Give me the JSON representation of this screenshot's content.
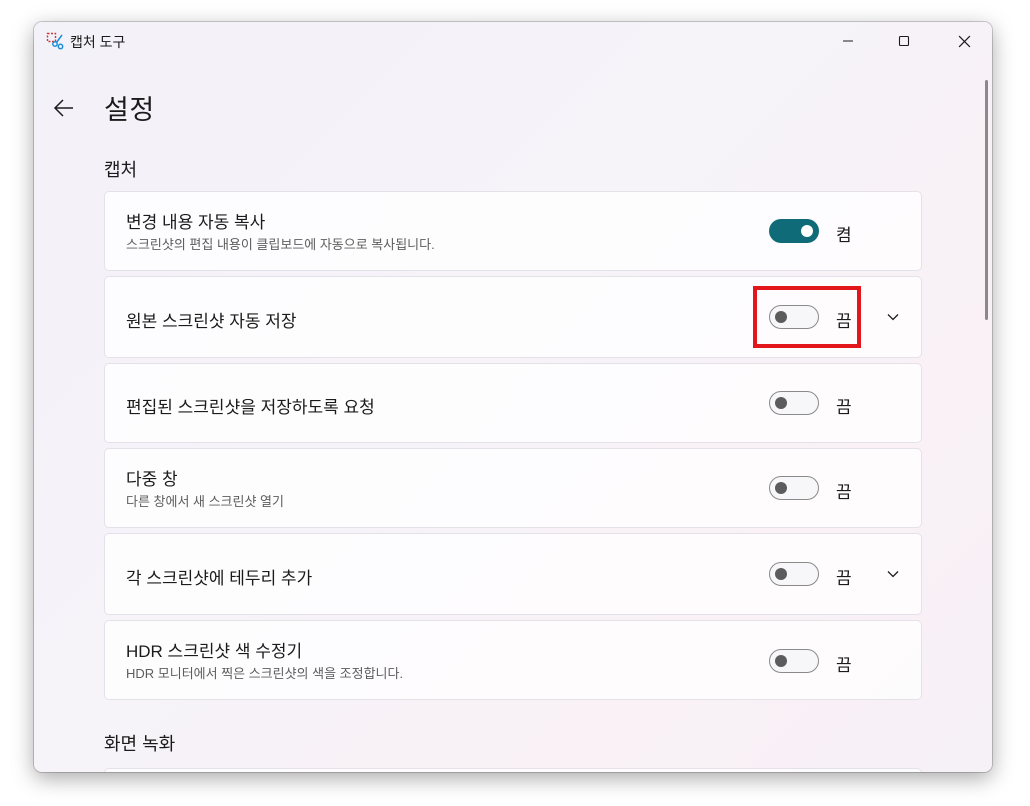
{
  "window": {
    "title": "캡처 도구",
    "app_icon": "snipping-tool-icon"
  },
  "page": {
    "title": "설정",
    "back_icon": "back-arrow-icon"
  },
  "sections": {
    "capture": {
      "header": "캡처"
    },
    "screen_recording": {
      "header": "화면 녹화"
    }
  },
  "settings": [
    {
      "title": "변경 내용 자동 복사",
      "description": "스크린샷의 편집 내용이 클립보드에 자동으로 복사됩니다.",
      "state": "켬",
      "on": true,
      "expandable": false
    },
    {
      "title": "원본 스크린샷 자동 저장",
      "description": "",
      "state": "끔",
      "on": false,
      "expandable": true
    },
    {
      "title": "편집된 스크린샷을 저장하도록 요청",
      "description": "",
      "state": "끔",
      "on": false,
      "expandable": false
    },
    {
      "title": "다중 창",
      "description": "다른 창에서 새 스크린샷 열기",
      "state": "끔",
      "on": false,
      "expandable": false
    },
    {
      "title": "각 스크린샷에 테두리 추가",
      "description": "",
      "state": "끔",
      "on": false,
      "expandable": true
    },
    {
      "title": "HDR 스크린샷 색 수정기",
      "description": "HDR 모니터에서 찍은 스크린샷의 색을 조정합니다.",
      "state": "끔",
      "on": false,
      "expandable": false
    }
  ],
  "colors": {
    "toggle_on": "#0f6b78",
    "highlight": "#e3161b"
  }
}
